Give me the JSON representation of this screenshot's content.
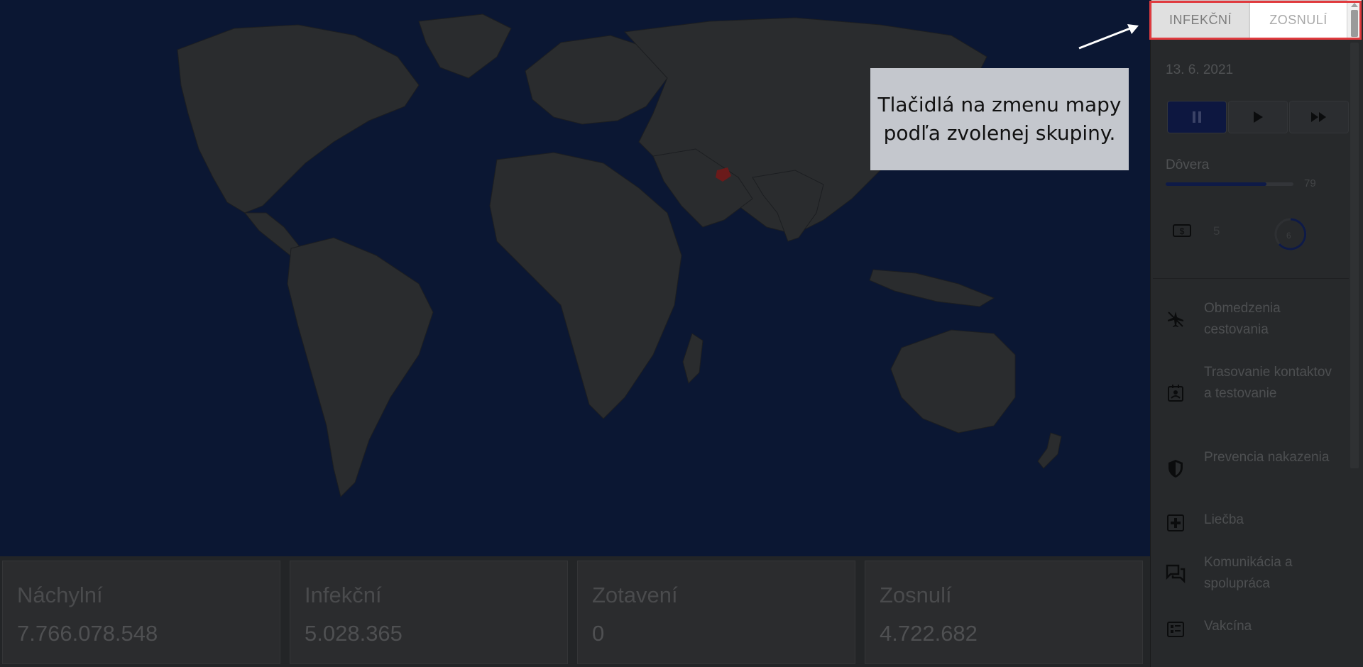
{
  "tabs": [
    {
      "label": "INFEKČNÍ",
      "selected": true
    },
    {
      "label": "ZOSNULÍ",
      "selected": false
    }
  ],
  "sidebar": {
    "date": "13. 6. 2021",
    "speed_controls": [
      {
        "icon": "pause-icon",
        "active": true
      },
      {
        "icon": "play-icon",
        "active": false
      },
      {
        "icon": "fast-forward-icon",
        "active": false
      }
    ],
    "trust": {
      "label": "Dôvera",
      "value": "79",
      "level_percent": 79
    },
    "money": {
      "icon": "money-icon",
      "value": "5"
    },
    "timer": {
      "value": "6"
    },
    "measures": [
      {
        "icon": "airplane-off-icon",
        "label": "Obmedzenia cestovania"
      },
      {
        "icon": "contact-badge-icon",
        "label": "Trasovanie kontaktov a testovanie"
      },
      {
        "icon": "shield-icon",
        "label": "Prevencia nakazenia"
      },
      {
        "icon": "medical-cross-icon",
        "label": "Liečba"
      },
      {
        "icon": "chat-icon",
        "label": "Komunikácia a spolupráca"
      },
      {
        "icon": "vaccine-icon",
        "label": "Vakcína"
      }
    ]
  },
  "stats": [
    {
      "label": "Náchylní",
      "value": "7.766.078.548"
    },
    {
      "label": "Infekční",
      "value": "5.028.365"
    },
    {
      "label": "Zotavení",
      "value": "0"
    },
    {
      "label": "Zosnulí",
      "value": "4.722.682"
    }
  ],
  "annotation": {
    "line1": "Tlačidlá na zmenu mapy",
    "line2": "podľa zvolenej skupiny."
  },
  "colors": {
    "map_background": "#0b1733",
    "land": "#2a2c2e",
    "highlight_country": "#6b1a1a",
    "highlight_box": "#e03a3e",
    "annotation_bg": "#c4c7cd"
  }
}
